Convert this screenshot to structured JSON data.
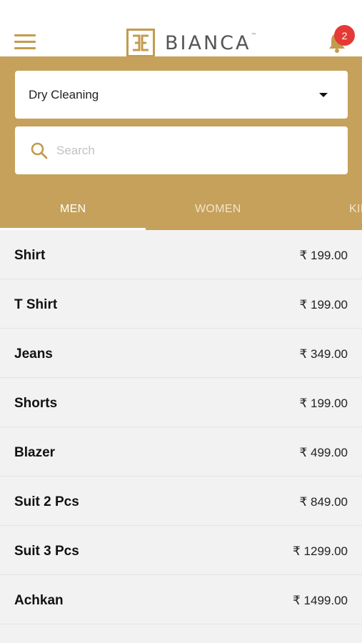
{
  "header": {
    "brand": "BIANCA",
    "brand_mark": "™",
    "notification_count": "2"
  },
  "service_select": {
    "selected": "Dry Cleaning"
  },
  "search": {
    "placeholder": "Search",
    "value": ""
  },
  "tabs": [
    {
      "label": "MEN",
      "active": true
    },
    {
      "label": "WOMEN",
      "active": false
    },
    {
      "label": "KIDS",
      "active": false
    }
  ],
  "items": [
    {
      "name": "Shirt",
      "price": "₹ 199.00"
    },
    {
      "name": "T Shirt",
      "price": "₹ 199.00"
    },
    {
      "name": "Jeans",
      "price": "₹ 349.00"
    },
    {
      "name": "Shorts",
      "price": "₹ 199.00"
    },
    {
      "name": "Blazer",
      "price": "₹ 499.00"
    },
    {
      "name": "Suit 2 Pcs",
      "price": "₹ 849.00"
    },
    {
      "name": "Suit 3 Pcs",
      "price": "₹ 1299.00"
    },
    {
      "name": "Achkan",
      "price": "₹ 1499.00"
    }
  ],
  "colors": {
    "accent": "#c5a15c",
    "badge": "#e53935",
    "list_background": "#f2f2f2"
  },
  "icons": [
    "menu-icon",
    "bell-icon",
    "search-icon",
    "caret-down-icon"
  ]
}
